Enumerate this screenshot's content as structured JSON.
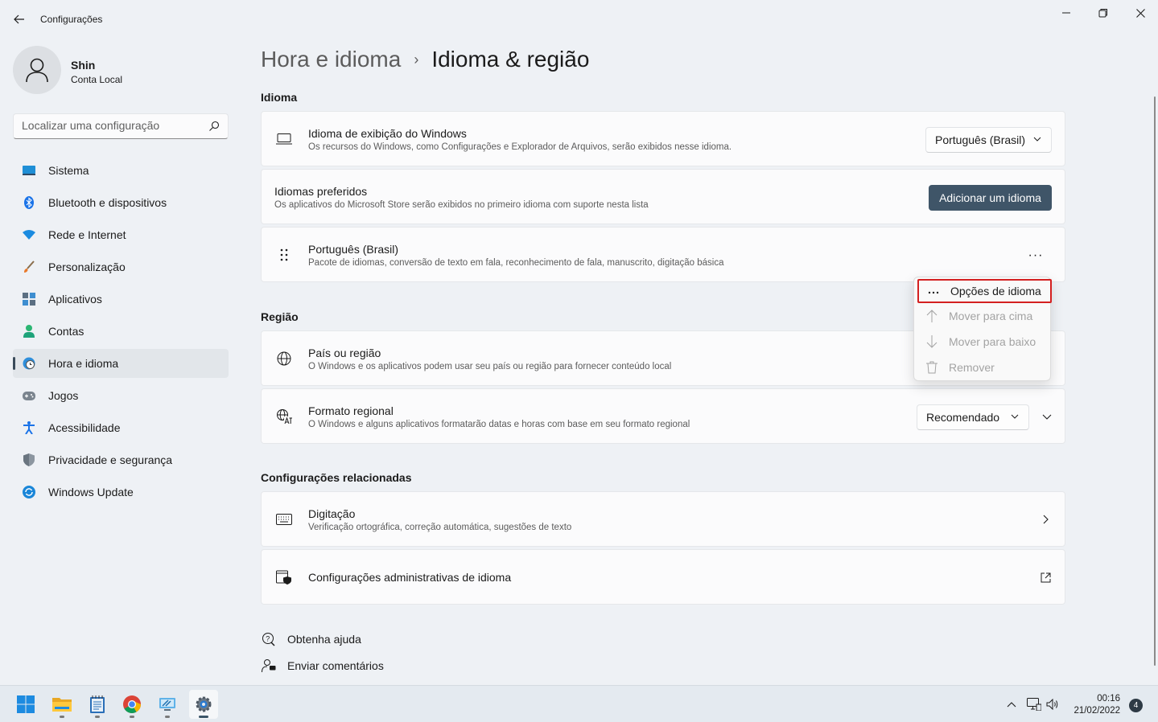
{
  "window": {
    "app_title": "Configurações"
  },
  "user": {
    "name": "Shin",
    "account_type": "Conta Local"
  },
  "search": {
    "placeholder": "Localizar uma configuração"
  },
  "nav": {
    "items": [
      {
        "label": "Sistema",
        "icon": "system-icon"
      },
      {
        "label": "Bluetooth e dispositivos",
        "icon": "bluetooth-icon"
      },
      {
        "label": "Rede e Internet",
        "icon": "wifi-icon"
      },
      {
        "label": "Personalização",
        "icon": "brush-icon"
      },
      {
        "label": "Aplicativos",
        "icon": "apps-icon"
      },
      {
        "label": "Contas",
        "icon": "accounts-icon"
      },
      {
        "label": "Hora e idioma",
        "icon": "time-language-icon",
        "active": true
      },
      {
        "label": "Jogos",
        "icon": "gamepad-icon"
      },
      {
        "label": "Acessibilidade",
        "icon": "accessibility-icon"
      },
      {
        "label": "Privacidade e segurança",
        "icon": "shield-icon"
      },
      {
        "label": "Windows Update",
        "icon": "update-icon"
      }
    ]
  },
  "breadcrumb": {
    "parent": "Hora e idioma",
    "separator": "›",
    "current": "Idioma & região"
  },
  "language_section": {
    "title": "Idioma",
    "display_language": {
      "title": "Idioma de exibição do Windows",
      "description": "Os recursos do Windows, como Configurações e Explorador de Arquivos, serão exibidos nesse idioma.",
      "selected": "Português (Brasil)"
    },
    "preferred": {
      "title": "Idiomas preferidos",
      "description": "Os aplicativos do Microsoft Store serão exibidos no primeiro idioma com suporte nesta lista",
      "add_button": "Adicionar um idioma"
    },
    "language_item": {
      "title": "Português (Brasil)",
      "description": "Pacote de idiomas, conversão de texto em fala, reconhecimento de fala, manuscrito, digitação básica",
      "more": "···"
    }
  },
  "context_menu": {
    "items": [
      {
        "label": "Opções de idioma",
        "icon": "more-icon",
        "enabled": true,
        "highlighted": true
      },
      {
        "label": "Mover para cima",
        "icon": "arrow-up-icon",
        "enabled": false
      },
      {
        "label": "Mover para baixo",
        "icon": "arrow-down-icon",
        "enabled": false
      },
      {
        "label": "Remover",
        "icon": "trash-icon",
        "enabled": false
      }
    ]
  },
  "region_section": {
    "title": "Região",
    "country": {
      "title": "País ou região",
      "description": "O Windows e os aplicativos podem usar seu país ou região para fornecer conteúdo local"
    },
    "format": {
      "title": "Formato regional",
      "description": "O Windows e alguns aplicativos formatarão datas e horas com base em seu formato regional",
      "selected": "Recomendado"
    }
  },
  "related_section": {
    "title": "Configurações relacionadas",
    "typing": {
      "title": "Digitação",
      "description": "Verificação ortográfica, correção automática, sugestões de texto"
    },
    "admin": {
      "title": "Configurações administrativas de idioma"
    }
  },
  "links": {
    "help": "Obtenha ajuda",
    "feedback": "Enviar comentários"
  },
  "taskbar": {
    "apps": [
      "start-icon",
      "file-explorer-icon",
      "notepad-icon",
      "chrome-icon",
      "remote-desktop-icon",
      "settings-icon"
    ],
    "time": "00:16",
    "date": "21/02/2022",
    "notifications": "4"
  },
  "colors": {
    "accent": "#3f5568",
    "highlight_border": "#d42020",
    "background": "#eef1f5"
  }
}
